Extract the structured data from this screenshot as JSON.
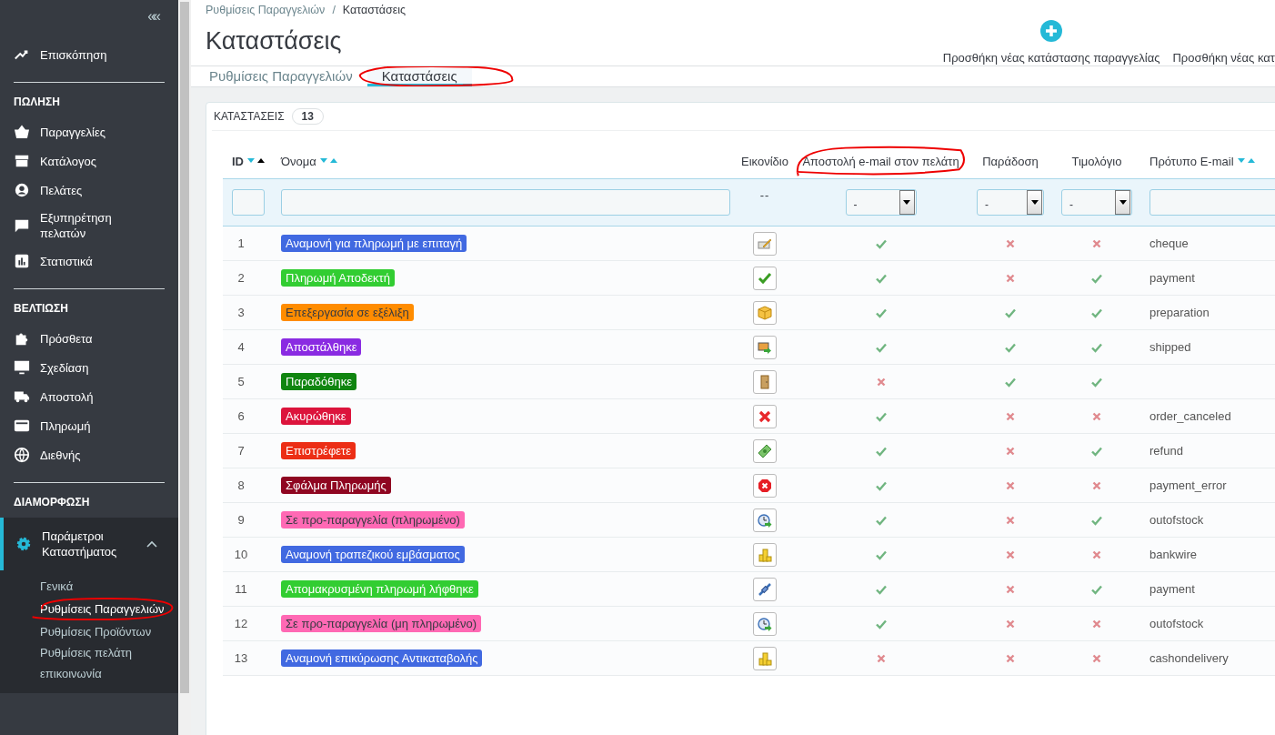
{
  "sidebar": {
    "collapse": "«",
    "groups": [
      {
        "items": [
          {
            "label": "Επισκόπηση",
            "selected": false
          }
        ]
      },
      {
        "heading": "ΠΩΛΗΣΗ",
        "items": [
          {
            "label": "Παραγγελίες",
            "selected": false
          },
          {
            "label": "Κατάλογος",
            "selected": false
          },
          {
            "label": "Πελάτες",
            "selected": false
          },
          {
            "label": "Εξυπηρέτηση πελατών",
            "selected": false
          },
          {
            "label": "Στατιστικά",
            "selected": false
          }
        ]
      },
      {
        "heading": "ΒΕΛΤΙΩΣΗ",
        "items": [
          {
            "label": "Πρόσθετα",
            "selected": false
          },
          {
            "label": "Σχεδίαση",
            "selected": false
          },
          {
            "label": "Αποστολή",
            "selected": false
          },
          {
            "label": "Πληρωμή",
            "selected": false
          },
          {
            "label": "Διεθνής",
            "selected": false
          }
        ]
      },
      {
        "heading": "ΔΙΑΜΟΡΦΩΣΗ",
        "items": [
          {
            "label": "Παράμετροι Καταστήματος",
            "selected": true,
            "expanded": true,
            "children": [
              {
                "label": "Γενικά",
                "selected": false,
                "circled": false
              },
              {
                "label": "Ρυθμίσεις Παραγγελιών",
                "selected": true,
                "circled": true
              },
              {
                "label": "Ρυθμίσεις Προϊόντων",
                "selected": false,
                "circled": false
              },
              {
                "label": "Ρυθμίσεις πελάτη",
                "selected": false,
                "circled": false
              },
              {
                "label": "επικοινωνία",
                "selected": false,
                "circled": false
              }
            ]
          }
        ]
      }
    ]
  },
  "breadcrumb": {
    "items": [
      "Ρυθμίσεις Παραγγελιών",
      "Καταστάσεις"
    ],
    "separator": "/"
  },
  "page_title": "Καταστάσεις",
  "toolbar": [
    {
      "label": "Προσθήκη νέας κατάστασης παραγγελίας",
      "icon": true
    },
    {
      "label": "Προσθήκη νέας κατ",
      "icon": false
    }
  ],
  "tabs": [
    {
      "label": "Ρυθμίσεις Παραγγελιών",
      "selected": false,
      "circled": false
    },
    {
      "label": "Καταστάσεις",
      "selected": true,
      "circled": true
    }
  ],
  "panel": {
    "title": "ΚΑΤΑΣΤΑΣΕΙΣ",
    "count": "13"
  },
  "table": {
    "columns": [
      {
        "label": "ID",
        "kind": "id",
        "sortable": true,
        "sorted_asc": true,
        "circled": false,
        "filter": {
          "kind": "text"
        }
      },
      {
        "label": "Όνομα",
        "kind": "name",
        "sortable": true,
        "sorted_asc": false,
        "circled": false,
        "filter": {
          "kind": "text"
        }
      },
      {
        "label": "Εικονίδιο",
        "kind": "icon",
        "circled": false,
        "filter": {
          "kind": "none",
          "text": "--"
        }
      },
      {
        "label": "Αποστολή e-mail στον πελάτη",
        "kind": "bool",
        "circled": true,
        "filter": {
          "kind": "select",
          "value": "-"
        }
      },
      {
        "label": "Παράδοση",
        "kind": "bool",
        "circled": false,
        "filter": {
          "kind": "select",
          "value": "-"
        }
      },
      {
        "label": "Τιμολόγιο",
        "kind": "bool",
        "circled": false,
        "filter": {
          "kind": "select",
          "value": "-"
        }
      },
      {
        "label": "Πρότυπο E-mail",
        "kind": "template",
        "sortable": true,
        "sorted_asc": false,
        "circled": false,
        "filter": {
          "kind": "text"
        }
      }
    ],
    "rows": [
      {
        "id": "1",
        "name": "Αναμονή για πληρωμή με επιταγή",
        "color": "#4169e1",
        "email": true,
        "delivery": false,
        "invoice": false,
        "template": "cheque"
      },
      {
        "id": "2",
        "name": "Πληρωμή Αποδεκτή",
        "color": "#32cd32",
        "email": true,
        "delivery": false,
        "invoice": true,
        "template": "payment"
      },
      {
        "id": "3",
        "name": "Επεξεργασία σε εξέλιξη",
        "color": "#ff8c00",
        "email": true,
        "delivery": true,
        "invoice": true,
        "template": "preparation"
      },
      {
        "id": "4",
        "name": "Αποστάλθηκε",
        "color": "#8a2be2",
        "email": true,
        "delivery": true,
        "invoice": true,
        "template": "shipped"
      },
      {
        "id": "5",
        "name": "Παραδόθηκε",
        "color": "#108510",
        "email": false,
        "delivery": true,
        "invoice": true
      },
      {
        "id": "6",
        "name": "Ακυρώθηκε",
        "color": "#dc143c",
        "email": true,
        "delivery": false,
        "invoice": false,
        "template": "order_canceled"
      },
      {
        "id": "7",
        "name": "Επιστρέφετε",
        "color": "#ec2e15",
        "email": true,
        "delivery": false,
        "invoice": true,
        "template": "refund"
      },
      {
        "id": "8",
        "name": "Σφάλμα Πληρωμής",
        "color": "#8f0621",
        "email": true,
        "delivery": false,
        "invoice": false,
        "template": "payment_error"
      },
      {
        "id": "9",
        "name": "Σε προ-παραγγελία (πληρωμένο)",
        "color": "#ff69b4",
        "email": true,
        "delivery": false,
        "invoice": true,
        "template": "outofstock"
      },
      {
        "id": "10",
        "name": "Αναμονή τραπεζικού εμβάσματος",
        "color": "#4169e1",
        "email": true,
        "delivery": false,
        "invoice": false,
        "template": "bankwire"
      },
      {
        "id": "11",
        "name": "Απομακρυσμένη πληρωμή λήφθηκε",
        "color": "#32cd32",
        "email": true,
        "delivery": false,
        "invoice": true,
        "template": "payment"
      },
      {
        "id": "12",
        "name": "Σε προ-παραγγελία (μη πληρωμένο)",
        "color": "#ff69b4",
        "email": true,
        "delivery": false,
        "invoice": false,
        "template": "outofstock"
      },
      {
        "id": "13",
        "name": "Αναμονή επικύρωσης Αντικαταβολής",
        "color": "#4169e1",
        "email": false,
        "delivery": false,
        "invoice": false,
        "template": "cashondelivery"
      }
    ]
  }
}
